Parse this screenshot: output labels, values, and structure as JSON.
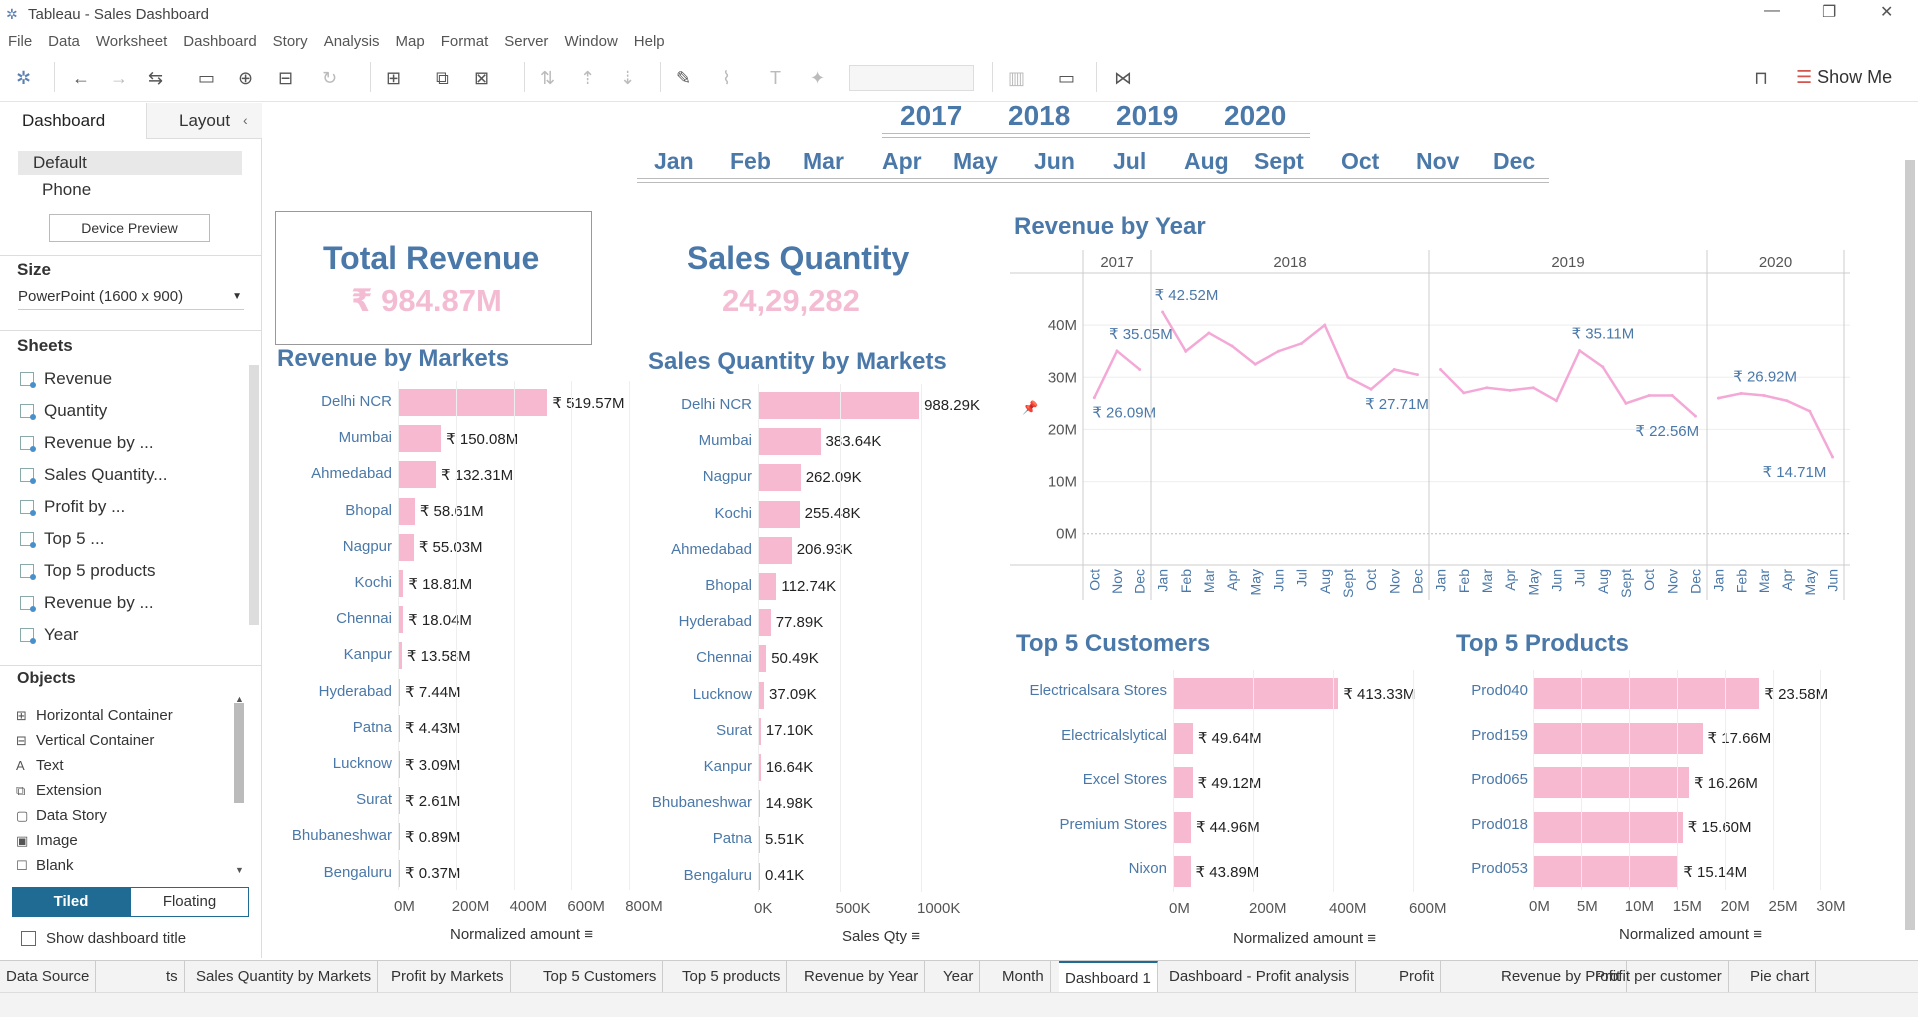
{
  "window": {
    "title": "Tableau - Sales Dashboard"
  },
  "menu": [
    "File",
    "Data",
    "Worksheet",
    "Dashboard",
    "Story",
    "Analysis",
    "Map",
    "Format",
    "Server",
    "Window",
    "Help"
  ],
  "toolbar": {
    "show_me": "Show Me"
  },
  "left_panel": {
    "tab_dashboard": "Dashboard",
    "tab_layout": "Layout",
    "device_default": "Default",
    "device_phone": "Phone",
    "device_preview": "Device Preview",
    "size_heading": "Size",
    "size_value": "PowerPoint (1600 x 900)",
    "sheets_heading": "Sheets",
    "sheets": [
      "Revenue",
      "Quantity",
      "Revenue by ...",
      "Sales Quantity...",
      "Profit by ...",
      "Top 5 ...",
      "Top 5 products",
      "Revenue by ...",
      "Year"
    ],
    "objects_heading": "Objects",
    "objects": [
      {
        "icon": "horizontal-container-icon",
        "glyph": "⊞",
        "label": "Horizontal Container"
      },
      {
        "icon": "vertical-container-icon",
        "glyph": "⊟",
        "label": "Vertical Container"
      },
      {
        "icon": "text-icon",
        "glyph": "A",
        "label": "Text"
      },
      {
        "icon": "extension-icon",
        "glyph": "⧉",
        "label": "Extension"
      },
      {
        "icon": "data-story-icon",
        "glyph": "▢",
        "label": "Data Story"
      },
      {
        "icon": "image-icon",
        "glyph": "▣",
        "label": "Image"
      },
      {
        "icon": "blank-icon",
        "glyph": "☐",
        "label": "Blank"
      }
    ],
    "tiled": "Tiled",
    "floating": "Floating",
    "show_title": "Show dashboard title"
  },
  "filters": {
    "years": [
      "2017",
      "2018",
      "2019",
      "2020"
    ],
    "months": [
      "Jan",
      "Feb",
      "Mar",
      "Apr",
      "May",
      "Jun",
      "Jul",
      "Aug",
      "Sept",
      "Oct",
      "Nov",
      "Dec"
    ]
  },
  "kpis": {
    "total_revenue_title": "Total Revenue",
    "total_revenue_value": "₹ 984.87M",
    "sales_qty_title": "Sales Quantity",
    "sales_qty_value": "24,29,282"
  },
  "revenue_by_markets": {
    "title": "Revenue by Markets",
    "axis_title": "Normalized amount",
    "ticks": [
      "0M",
      "200M",
      "400M",
      "600M",
      "800M"
    ],
    "rows": [
      {
        "market": "Delhi NCR",
        "value": 519.57,
        "label": "₹ 519.57M"
      },
      {
        "market": "Mumbai",
        "value": 150.08,
        "label": "₹ 150.08M"
      },
      {
        "market": "Ahmedabad",
        "value": 132.31,
        "label": "₹ 132.31M"
      },
      {
        "market": "Bhopal",
        "value": 58.61,
        "label": "₹ 58.61M"
      },
      {
        "market": "Nagpur",
        "value": 55.03,
        "label": "₹ 55.03M"
      },
      {
        "market": "Kochi",
        "value": 18.81,
        "label": "₹ 18.81M"
      },
      {
        "market": "Chennai",
        "value": 18.04,
        "label": "₹ 18.04M"
      },
      {
        "market": "Kanpur",
        "value": 13.58,
        "label": "₹ 13.58M"
      },
      {
        "market": "Hyderabad",
        "value": 7.44,
        "label": "₹ 7.44M"
      },
      {
        "market": "Patna",
        "value": 4.43,
        "label": "₹ 4.43M"
      },
      {
        "market": "Lucknow",
        "value": 3.09,
        "label": "₹ 3.09M"
      },
      {
        "market": "Surat",
        "value": 2.61,
        "label": "₹ 2.61M"
      },
      {
        "market": "Bhubaneshwar",
        "value": 0.89,
        "label": "₹ 0.89M"
      },
      {
        "market": "Bengaluru",
        "value": 0.37,
        "label": "₹ 0.37M"
      }
    ]
  },
  "sales_qty_by_markets": {
    "title": "Sales Quantity by Markets",
    "axis_title": "Sales Qty",
    "ticks": [
      "0K",
      "500K",
      "1000K"
    ],
    "rows": [
      {
        "market": "Delhi NCR",
        "value": 988.29,
        "label": "988.29K"
      },
      {
        "market": "Mumbai",
        "value": 383.64,
        "label": "383.64K"
      },
      {
        "market": "Nagpur",
        "value": 262.09,
        "label": "262.09K"
      },
      {
        "market": "Kochi",
        "value": 255.48,
        "label": "255.48K"
      },
      {
        "market": "Ahmedabad",
        "value": 206.93,
        "label": "206.93K"
      },
      {
        "market": "Bhopal",
        "value": 112.74,
        "label": "112.74K"
      },
      {
        "market": "Hyderabad",
        "value": 77.89,
        "label": "77.89K"
      },
      {
        "market": "Chennai",
        "value": 50.49,
        "label": "50.49K"
      },
      {
        "market": "Lucknow",
        "value": 37.09,
        "label": "37.09K"
      },
      {
        "market": "Surat",
        "value": 17.1,
        "label": "17.10K"
      },
      {
        "market": "Kanpur",
        "value": 16.64,
        "label": "16.64K"
      },
      {
        "market": "Bhubaneshwar",
        "value": 14.98,
        "label": "14.98K"
      },
      {
        "market": "Patna",
        "value": 5.51,
        "label": "5.51K"
      },
      {
        "market": "Bengaluru",
        "value": 0.41,
        "label": "0.41K"
      }
    ]
  },
  "top_customers": {
    "title": "Top 5 Customers",
    "axis_title": "Normalized amount",
    "ticks": [
      "0M",
      "200M",
      "400M",
      "600M"
    ],
    "rows": [
      {
        "name": "Electricalsara Stores",
        "value": 413.33,
        "label": "₹ 413.33M"
      },
      {
        "name": "Electricalslytical",
        "value": 49.64,
        "label": "₹ 49.64M"
      },
      {
        "name": "Excel Stores",
        "value": 49.12,
        "label": "₹ 49.12M"
      },
      {
        "name": "Premium Stores",
        "value": 44.96,
        "label": "₹ 44.96M"
      },
      {
        "name": "Nixon",
        "value": 43.89,
        "label": "₹ 43.89M"
      }
    ]
  },
  "top_products": {
    "title": "Top 5 Products",
    "axis_title": "Normalized amount",
    "ticks": [
      "0M",
      "5M",
      "10M",
      "15M",
      "20M",
      "25M",
      "30M"
    ],
    "rows": [
      {
        "name": "Prod040",
        "value": 23.58,
        "label": "₹ 23.58M"
      },
      {
        "name": "Prod159",
        "value": 17.66,
        "label": "₹ 17.66M"
      },
      {
        "name": "Prod065",
        "value": 16.26,
        "label": "₹ 16.26M"
      },
      {
        "name": "Prod018",
        "value": 15.6,
        "label": "₹ 15.60M"
      },
      {
        "name": "Prod053",
        "value": 15.14,
        "label": "₹ 15.14M"
      }
    ]
  },
  "chart_data": {
    "type": "line",
    "title": "Revenue by Year",
    "y_ticks": [
      "0M",
      "10M",
      "20M",
      "30M",
      "40M"
    ],
    "ylim": [
      -6,
      50
    ],
    "panels": [
      {
        "year": "2017",
        "months": [
          "Oct",
          "Nov",
          "Dec"
        ],
        "values": [
          26.09,
          35.05,
          31.5
        ]
      },
      {
        "year": "2018",
        "months": [
          "Jan",
          "Feb",
          "Mar",
          "Apr",
          "May",
          "Jun",
          "Jul",
          "Aug",
          "Sept",
          "Oct",
          "Nov",
          "Dec"
        ],
        "values": [
          42.52,
          35.0,
          38.5,
          36.0,
          32.5,
          35.0,
          36.5,
          40.0,
          30.0,
          27.71,
          31.5,
          30.5
        ]
      },
      {
        "year": "2019",
        "months": [
          "Jan",
          "Feb",
          "Mar",
          "Apr",
          "May",
          "Jun",
          "Jul",
          "Aug",
          "Sept",
          "Oct",
          "Nov",
          "Dec"
        ],
        "values": [
          31.5,
          27.0,
          28.0,
          27.5,
          28.0,
          25.5,
          35.11,
          32.0,
          25.0,
          26.5,
          26.5,
          22.56
        ]
      },
      {
        "year": "2020",
        "months": [
          "Jan",
          "Feb",
          "Mar",
          "Apr",
          "May",
          "Jun"
        ],
        "values": [
          26.0,
          26.92,
          26.5,
          25.5,
          23.5,
          14.71
        ]
      }
    ],
    "annotations": [
      "₹ 35.05M",
      "₹ 26.09M",
      "₹ 42.52M",
      "₹ 27.71M",
      "₹ 35.11M",
      "₹ 22.56M",
      "₹ 26.92M",
      "₹ 14.71M"
    ],
    "color": "#f4a8d6"
  },
  "tabs": [
    "Data Source",
    "ts",
    "Sales Quantity by Markets",
    "Profit by Markets",
    "Top 5 Customers",
    "Top 5 products",
    "Revenue by Year",
    "Year",
    "Month",
    "Dashboard 1",
    "Dashboard - Profit analysis",
    "Profit",
    "Revenue by Profit",
    "Profit per customer",
    "Pie chart"
  ],
  "colors": {
    "accent": "#4a78a8",
    "bar": "#f7b9d0",
    "kpi_value": "#f4bcd3",
    "tiled": "#1f6b93"
  }
}
